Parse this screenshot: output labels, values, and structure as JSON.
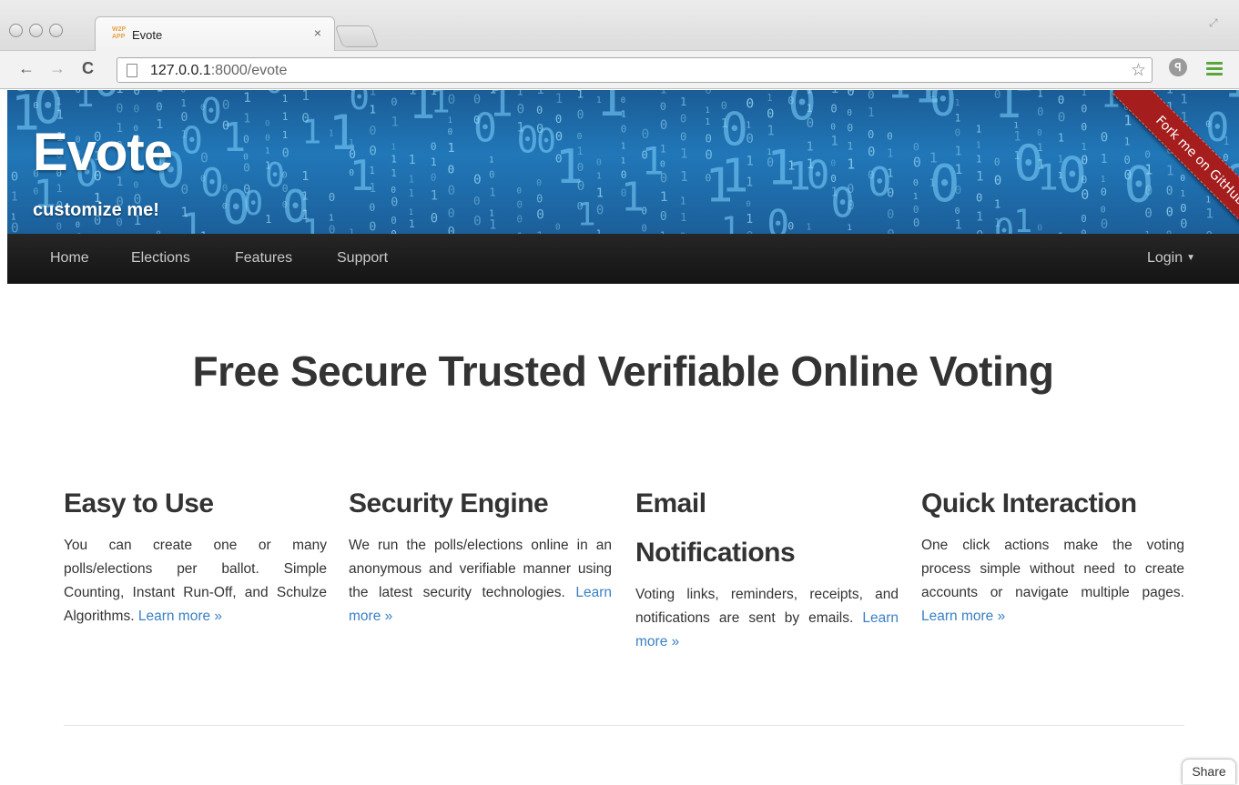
{
  "browser": {
    "tab_favicon_text": "W2P APP",
    "tab_title": "Evote",
    "tab_close": "×",
    "back_icon": "←",
    "forward_icon": "→",
    "reload_icon": "C",
    "url_host": "127.0.0.1",
    "url_rest": ":8000/evote",
    "star_icon": "☆",
    "extension_icon": "ꟼ"
  },
  "banner": {
    "brand": "Evote",
    "tagline": "customize me!",
    "ribbon": "Fork me on GitHub"
  },
  "navbar": {
    "items": [
      {
        "label": "Home"
      },
      {
        "label": "Elections"
      },
      {
        "label": "Features"
      },
      {
        "label": "Support"
      }
    ],
    "login": "Login"
  },
  "hero": {
    "title": "Free Secure Trusted Verifiable Online Voting"
  },
  "features": [
    {
      "title": "Easy to Use",
      "text": "You can create one or many polls/elections per ballot. Simple Counting, Instant Run-Off, and Schulze Algorithms.",
      "link": "Learn more »"
    },
    {
      "title": "Security Engine",
      "text": "We run the polls/elections online in an anonymous and verifiable manner using the latest security technologies.",
      "link": "Learn more »"
    },
    {
      "title": "Email Notifications",
      "text": "Voting links, reminders, receipts, and notifications are sent by emails.",
      "link": "Learn more »"
    },
    {
      "title": "Quick Interaction",
      "text": "One click actions make the voting process simple without need to create accounts or navigate multiple pages.",
      "link": "Learn more »"
    }
  ],
  "share": "Share",
  "colors": {
    "banner_blue": "#2177b8",
    "navbar": "#1b1b1b",
    "link": "#3a80c4",
    "ribbon": "#a51d1d"
  }
}
